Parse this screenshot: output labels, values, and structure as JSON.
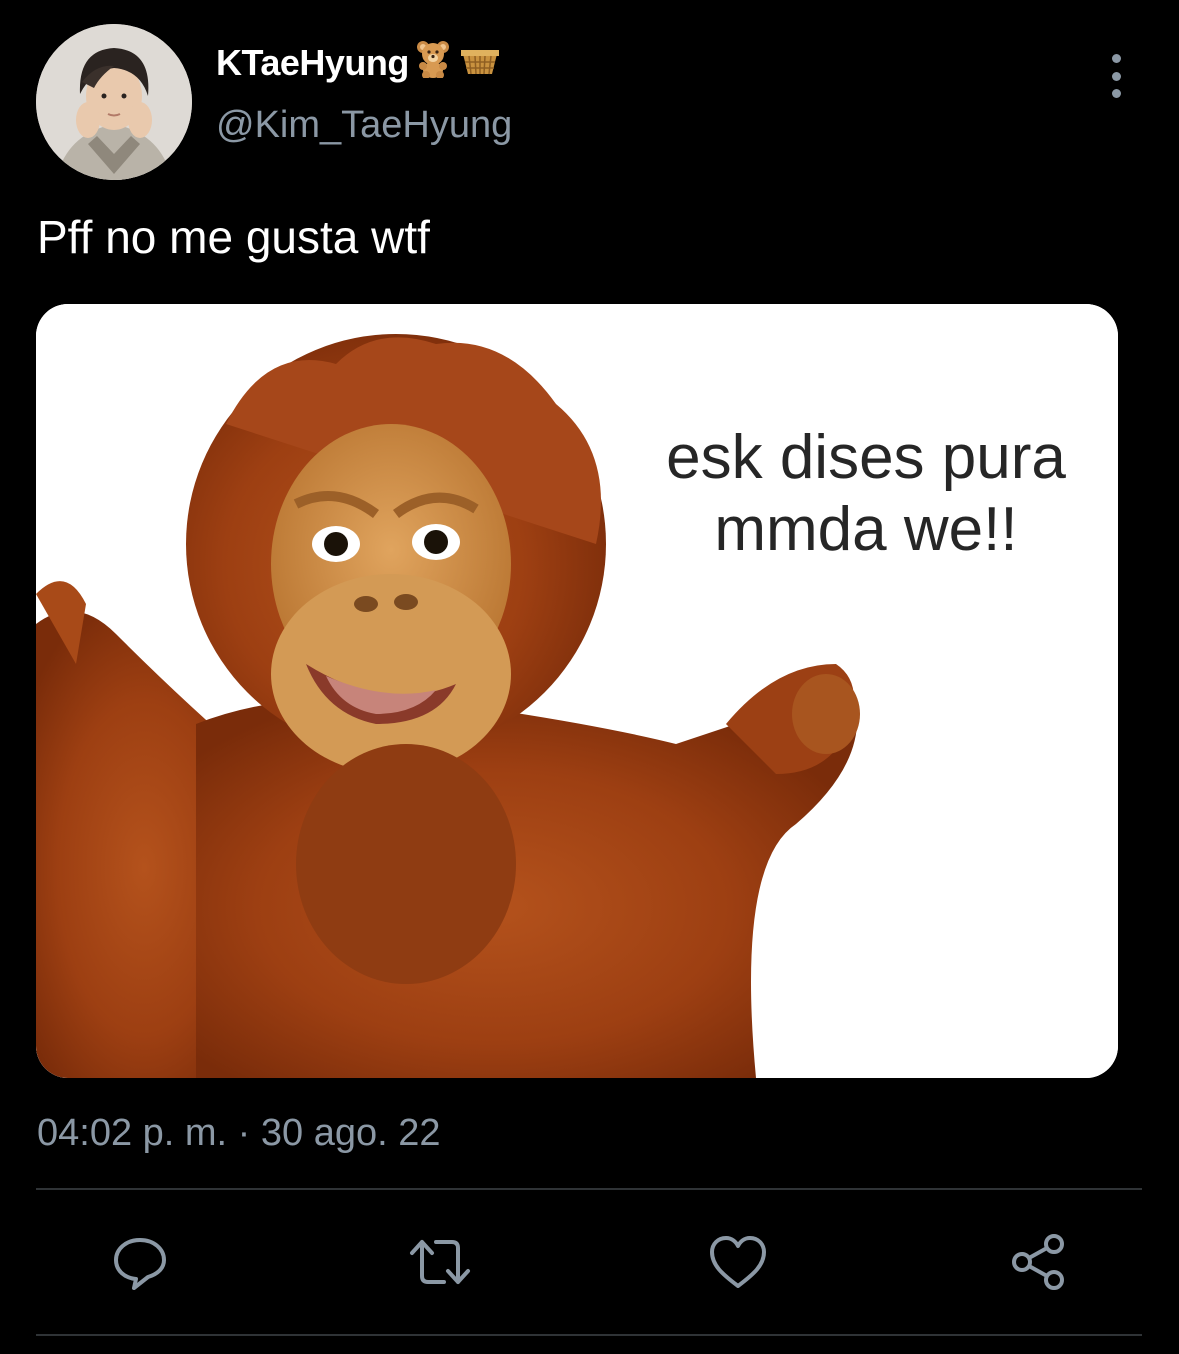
{
  "author": {
    "display_name": "KTaeHyung",
    "name_emojis": [
      "teddy-bear-emoji",
      "basket-emoji"
    ],
    "handle": "@Kim_TaeHyung",
    "avatar": "profile-photo"
  },
  "tweet": {
    "text": "Pff no me gusta wtf",
    "media": {
      "type": "meme-image",
      "caption": "esk dises pura\nmmda we!!"
    },
    "timestamp": "04:02 p. m. · 30 ago. 22"
  },
  "actions": {
    "reply_icon": "reply-icon",
    "retweet_icon": "retweet-icon",
    "like_icon": "heart-icon",
    "share_icon": "share-icon"
  },
  "menu": {
    "icon": "more-vertical-icon"
  },
  "colors": {
    "background": "#000000",
    "primary_text": "#ffffff",
    "secondary_text": "#8b98a5",
    "divider": "#2f3336"
  }
}
